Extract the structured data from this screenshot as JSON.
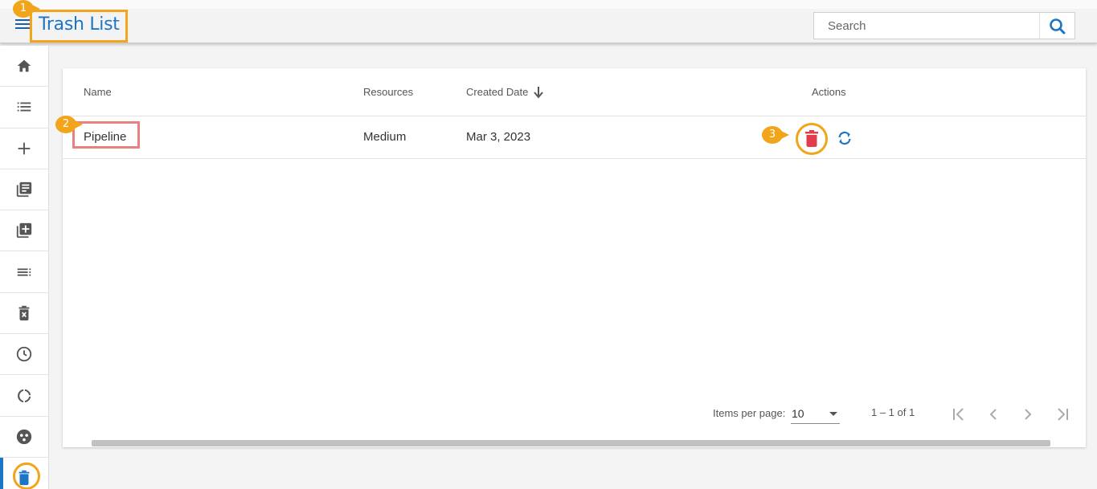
{
  "header": {
    "title": "Trash List",
    "search_placeholder": "Search"
  },
  "annotations": [
    "1",
    "2",
    "3"
  ],
  "sidebar": {
    "items": [
      {
        "icon": "home-icon"
      },
      {
        "icon": "list-icon"
      },
      {
        "icon": "plus-icon"
      },
      {
        "icon": "library-icon"
      },
      {
        "icon": "add-box-icon"
      },
      {
        "icon": "list-sort-icon"
      },
      {
        "icon": "trash-x-icon"
      },
      {
        "icon": "clock-icon"
      },
      {
        "icon": "progress-ring-icon"
      },
      {
        "icon": "group-icon"
      },
      {
        "icon": "trash-icon",
        "active": true
      }
    ]
  },
  "table": {
    "columns": [
      "Name",
      "Resources",
      "Created Date",
      "Actions"
    ],
    "rows": [
      {
        "name": "Pipeline",
        "resources": "Medium",
        "created_date": "Mar 3, 2023"
      }
    ]
  },
  "paginator": {
    "items_per_page_label": "Items per page:",
    "items_per_page": "10",
    "range": "1 – 1 of 1"
  },
  "colors": {
    "accent": "#1d76c3",
    "highlight": "#f2a51a",
    "danger": "#e03c4a",
    "name_highlight": "#e88080"
  }
}
